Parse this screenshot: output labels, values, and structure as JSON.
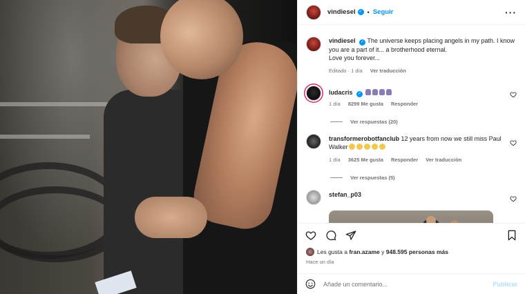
{
  "post": {
    "author": "vindiesel",
    "follow_label": "Seguir",
    "caption": "The universe keeps placing angels in my path. I know you are a part of it... a brotherhood eternal.",
    "caption_line2": "Love you forever...",
    "edited_label": "Editado",
    "caption_time": "1 día",
    "translate_label": "Ver traducción"
  },
  "comments": [
    {
      "user": "ludacris",
      "verified": true,
      "text_emoji": [
        "folded-hands",
        "folded-hands",
        "folded-hands",
        "folded-hands"
      ],
      "time": "1 día",
      "likes": "8299 Me gusta",
      "reply_label": "Responder",
      "view_replies": "Ver respuestas (20)"
    },
    {
      "user": "transformerobotfanclub",
      "text": "12 years from now we still miss Paul",
      "text_line2": "Walker",
      "text_emoji": [
        "sad-face",
        "sad-face",
        "sad-face",
        "sad-face",
        "sad-face"
      ],
      "time": "1 día",
      "likes": "3625 Me gusta",
      "reply_label": "Responder",
      "translate_label": "Ver traducción",
      "view_replies": "Ver respuestas (5)"
    },
    {
      "user": "stefan_p03"
    }
  ],
  "actions": {
    "icons": [
      "heart-icon",
      "comment-icon",
      "share-icon",
      "bookmark-icon"
    ]
  },
  "likes_line": {
    "prefix": "Les gusta a",
    "user": "fran.azame",
    "joiner": "y",
    "count": "948.595 personas más"
  },
  "post_time": "Hace un día",
  "composer": {
    "placeholder": "Añade un comentario...",
    "publish_label": "Publicar"
  },
  "colors": {
    "accent": "#0095f6",
    "verified": "#0095f6",
    "muted": "#737373"
  }
}
